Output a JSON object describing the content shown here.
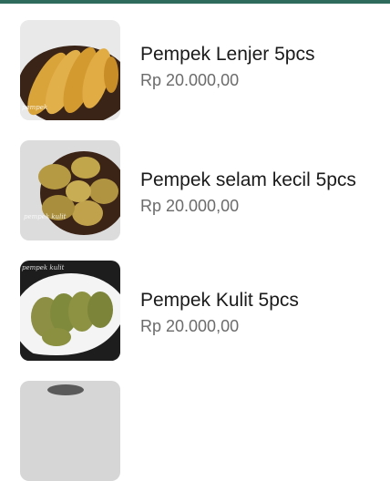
{
  "products": [
    {
      "name": "Pempek Lenjer 5pcs",
      "price": "Rp 20.000,00"
    },
    {
      "name": "Pempek selam kecil 5pcs",
      "price": "Rp 20.000,00"
    },
    {
      "name": "Pempek Kulit 5pcs",
      "price": "Rp 20.000,00"
    }
  ],
  "colors": {
    "top_bar": "#2f6b5d",
    "name_text": "#1a1a1a",
    "price_text": "#6b6b6b"
  }
}
